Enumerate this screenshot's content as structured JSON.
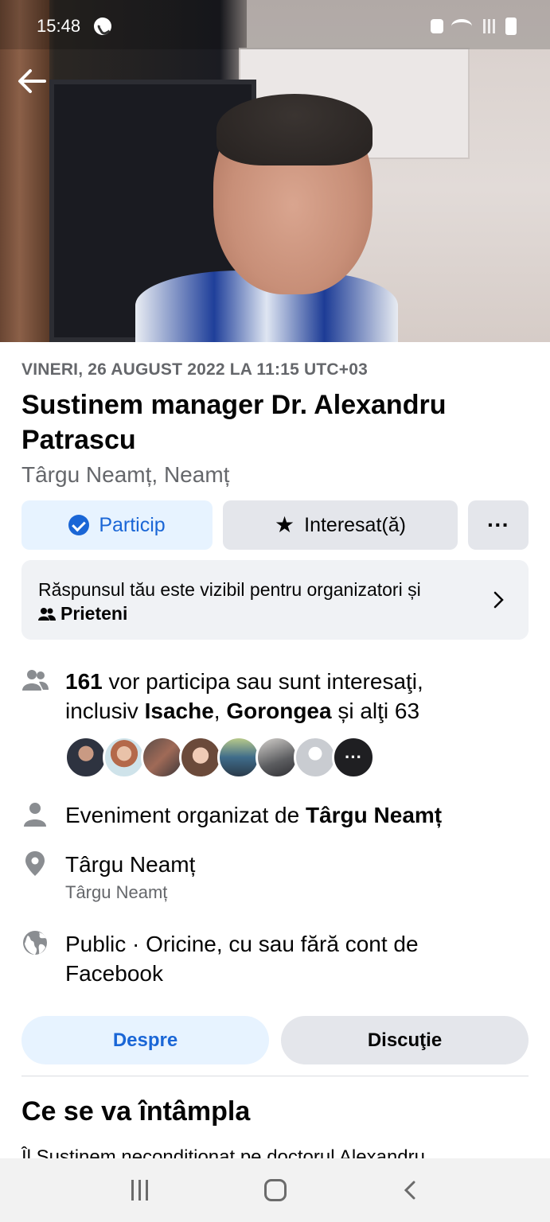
{
  "status_bar": {
    "time": "15:48"
  },
  "event": {
    "date": "VINERI, 26 AUGUST 2022 LA 11:15 UTC+03",
    "title": "Sustinem manager Dr. Alexandru Patrascu",
    "location_line": "Târgu Neamț, Neamț"
  },
  "actions": {
    "going_label": "Particip",
    "interested_label": "Interesat(ă)",
    "more_label": "···"
  },
  "visibility": {
    "text": "Răspunsul tău este vizibil pentru organizatori și",
    "audience": "Prieteni"
  },
  "attendance": {
    "count": "161",
    "text_1": "vor participa sau sunt interesaţi,",
    "text_2": "inclusiv",
    "name_1": "Isache",
    "comma": ",",
    "name_2": "Gorongea",
    "text_3": "și alţi 63",
    "more_avatars": "···"
  },
  "organizer": {
    "prefix": "Eveniment organizat de",
    "name": "Târgu Neamț"
  },
  "place": {
    "name": "Târgu Neamț",
    "sub": "Târgu Neamț"
  },
  "privacy": {
    "text": "Public · Oricine, cu sau fără cont de Facebook"
  },
  "tabs": {
    "about": "Despre",
    "discussion": "Discuţie"
  },
  "section": {
    "title": "Ce se va întâmpla",
    "preview": "Îl Sustinem neconditionat pe doctorul Alexandru"
  },
  "colors": {
    "accent": "#1a66d6",
    "accent_bg": "#e7f3ff",
    "button_bg": "#e4e6eb",
    "secondary_text": "#65676b"
  }
}
